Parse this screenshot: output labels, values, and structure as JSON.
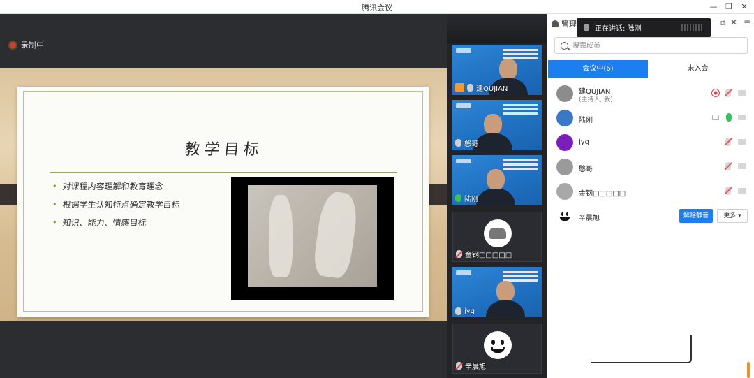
{
  "window": {
    "title": "腾讯会议",
    "controls": {
      "minimize": "—",
      "restore": "❐",
      "close": "✕"
    }
  },
  "recording": {
    "label": "录制中",
    "color": "#d43a3a"
  },
  "slide": {
    "title": "教学目标",
    "bullets": [
      "对课程内容理解和教育理念",
      "根据学生认知特点确定教学目标",
      "知识、能力、情感目标"
    ],
    "accent": "#9aa45a"
  },
  "video_tiles": [
    {
      "name": "建QUJIAN",
      "mic": "on",
      "host": true
    },
    {
      "name": "憨哥",
      "mic": "on",
      "host": false
    },
    {
      "name": "陆刚",
      "mic": "on",
      "host": false
    },
    {
      "name": "金钢□□□□□",
      "mic": "on",
      "host": false
    },
    {
      "name": "jyg",
      "mic": "on",
      "host": false
    },
    {
      "name": "辛晨旭",
      "mic": "on",
      "host": false
    }
  ],
  "panel": {
    "title": "管理成",
    "speaking_label": "正在讲话: 陆刚",
    "search_placeholder": "搜索成员",
    "tabs": [
      {
        "label": "会议中(6)",
        "active": true
      },
      {
        "label": "未入会",
        "active": false
      }
    ],
    "members": [
      {
        "name": "建QUJIAN",
        "sub": "(主持人, 我)",
        "avatar_color": "#8c8c8c"
      },
      {
        "name": "陆刚",
        "sub": "",
        "avatar_color": "#3a77c6"
      },
      {
        "name": "jyg",
        "sub": "",
        "avatar_color": "#7a1fb8"
      },
      {
        "name": "憨哥",
        "sub": "",
        "avatar_color": "#9a9a9a"
      },
      {
        "name": "金钢□□□□□",
        "sub": "",
        "avatar_color": "#a8a8a8"
      },
      {
        "name": "辛晨旭",
        "sub": "",
        "avatar_color": "#ffffff"
      }
    ],
    "unmute_label": "解除静音",
    "more_label": "更多 ▾",
    "accent": "#1e7ef0"
  }
}
